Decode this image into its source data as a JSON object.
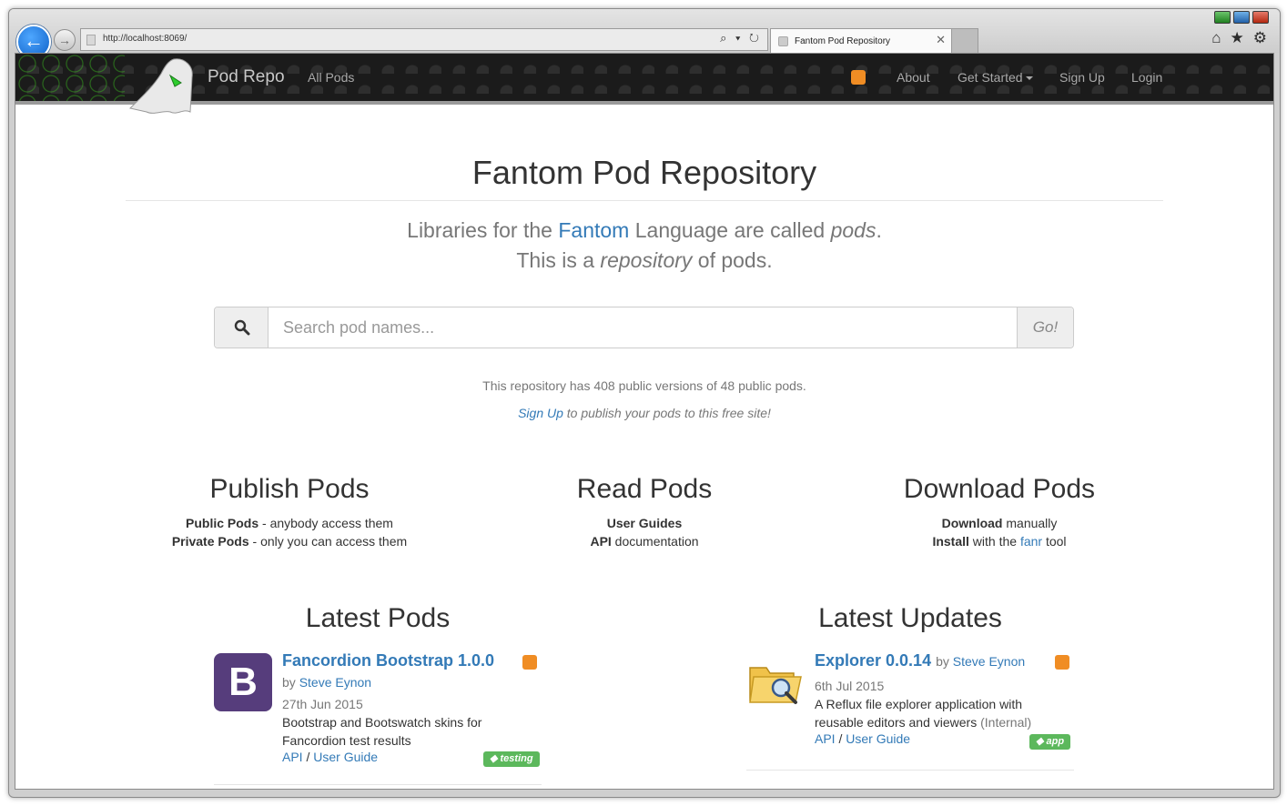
{
  "browser": {
    "url": "http://localhost:8069/",
    "tab_title": "Fantom Pod Repository",
    "address_tools": "⌕ ▾ ↻",
    "icons": [
      "home-icon",
      "star-icon",
      "gear-icon"
    ]
  },
  "navbar": {
    "brand": "Pod Repo",
    "all_pods": "All Pods",
    "about": "About",
    "get_started": "Get Started",
    "sign_up": "Sign Up",
    "login": "Login"
  },
  "hero": {
    "title": "Fantom Pod Repository",
    "line1_pre": "Libraries for the ",
    "line1_link": "Fantom",
    "line1_mid": " Language are called ",
    "line1_em": "pods",
    "line1_post": ".",
    "line2_pre": "This is a ",
    "line2_em": "repository",
    "line2_post": " of pods."
  },
  "search": {
    "placeholder": "Search pod names...",
    "go_label": "Go!"
  },
  "stats": {
    "text": "This repository has 408 public versions of 48 public pods.",
    "signup_link": "Sign Up",
    "signup_rest": " to publish your pods to this free site!"
  },
  "features": {
    "publish": {
      "title": "Publish Pods",
      "l1_bold": "Public Pods",
      "l1_rest": " - anybody access them",
      "l2_bold": "Private Pods",
      "l2_rest": " - only you can access them"
    },
    "read": {
      "title": "Read Pods",
      "l1_bold": "User Guides",
      "l2_bold": "API",
      "l2_rest": " documentation"
    },
    "download": {
      "title": "Download Pods",
      "l1_bold": "Download",
      "l1_rest": " manually",
      "l2_bold": "Install",
      "l2_mid": " with the ",
      "l2_link": "fanr",
      "l2_rest": " tool"
    }
  },
  "latest_pods": {
    "title": "Latest Pods",
    "item": {
      "icon_letter": "B",
      "name": "Fancordion Bootstrap 1.0.0",
      "by": "by",
      "author": "Steve Eynon",
      "date": "27th Jun 2015",
      "desc": "Bootstrap and Bootswatch skins for Fancordion test results",
      "api": "API",
      "sep": " / ",
      "guide": "User Guide",
      "tag": "testing",
      "colors": {
        "icon_bg": "#563d7c",
        "tag": "#5cb85c"
      }
    }
  },
  "latest_updates": {
    "title": "Latest Updates",
    "item": {
      "name": "Explorer 0.0.14",
      "by": "by",
      "author": "Steve Eynon",
      "date": "6th Jul 2015",
      "desc": "A Reflux file explorer application with reusable editors and viewers",
      "internal": " (Internal)",
      "api": "API",
      "sep": " / ",
      "guide": "User Guide",
      "tag": "app"
    }
  },
  "colors": {
    "link": "#337ab7",
    "rss": "#f08d24",
    "navbar": "#1b1b1b"
  }
}
